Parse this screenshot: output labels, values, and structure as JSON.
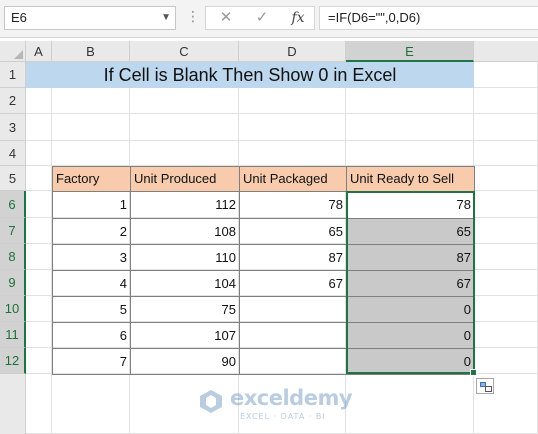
{
  "formula_bar": {
    "name_box": "E6",
    "dropdown_icon": "chevron-down-icon",
    "dots": "⋮",
    "cancel_symbol": "✕",
    "enter_symbol": "✓",
    "fx_label": "fx",
    "formula": "=IF(D6=\"\",0,D6)"
  },
  "columns": [
    "A",
    "B",
    "C",
    "D",
    "E"
  ],
  "rows": [
    "1",
    "2",
    "3",
    "4",
    "5",
    "6",
    "7",
    "8",
    "9",
    "10",
    "11",
    "12"
  ],
  "title": "If Cell is Blank Then Show 0 in Excel",
  "table": {
    "headers": [
      "Factory",
      "Unit Produced",
      "Unit Packaged",
      "Unit Ready to Sell"
    ],
    "rows": [
      [
        "1",
        "112",
        "78",
        "78"
      ],
      [
        "2",
        "108",
        "65",
        "65"
      ],
      [
        "3",
        "110",
        "87",
        "87"
      ],
      [
        "4",
        "104",
        "67",
        "67"
      ],
      [
        "5",
        "75",
        "",
        "0"
      ],
      [
        "6",
        "107",
        "",
        "0"
      ],
      [
        "7",
        "90",
        "",
        "0"
      ]
    ]
  },
  "selection": {
    "active_cell": "E6",
    "range": "E6:E12"
  },
  "colors": {
    "title_fill": "#bdd7ee",
    "header_fill": "#f8cbad",
    "output_fill": "#c9c9c9",
    "selection": "#217346"
  },
  "watermark": {
    "name": "exceldemy",
    "tagline": "EXCEL · DATA · BI"
  }
}
